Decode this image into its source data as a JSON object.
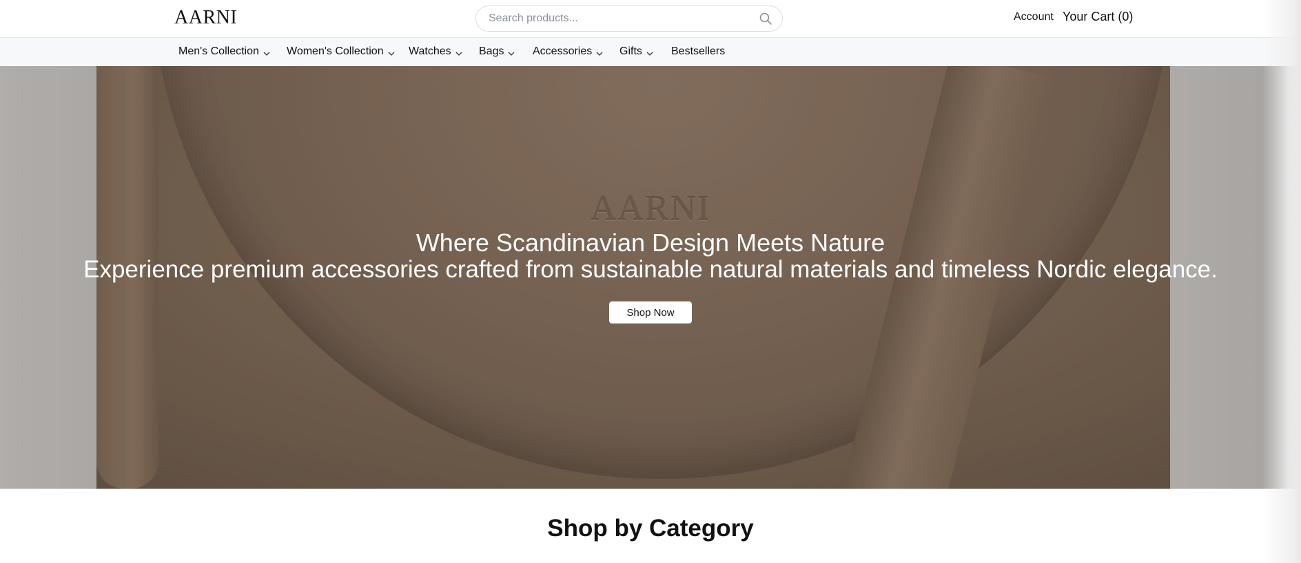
{
  "header": {
    "logo": "AARNI",
    "search_placeholder": "Search products...",
    "account_label": "Account",
    "cart_label": "Your Cart (0)"
  },
  "nav": {
    "items": [
      {
        "label": "Men's Collection",
        "has_dropdown": true
      },
      {
        "label": "Women's Collection",
        "has_dropdown": true
      },
      {
        "label": "Watches",
        "has_dropdown": true
      },
      {
        "label": "Bags",
        "has_dropdown": true
      },
      {
        "label": "Accessories",
        "has_dropdown": true
      },
      {
        "label": "Gifts",
        "has_dropdown": true
      },
      {
        "label": "Bestsellers",
        "has_dropdown": false
      }
    ]
  },
  "hero": {
    "embossed_logo": "AARNI",
    "title": "Where Scandinavian Design Meets Nature",
    "subtitle": "Experience premium accessories crafted from sustainable natural materials and timeless Nordic elegance.",
    "cta_label": "Shop Now"
  },
  "sections": {
    "category_heading": "Shop by Category"
  },
  "icons": {
    "search": "search-icon",
    "dropdown": "chevron-down-icon"
  },
  "colors": {
    "hero_leather": "#7d6958",
    "nav_background": "#f7f8fa",
    "text": "#111111"
  }
}
